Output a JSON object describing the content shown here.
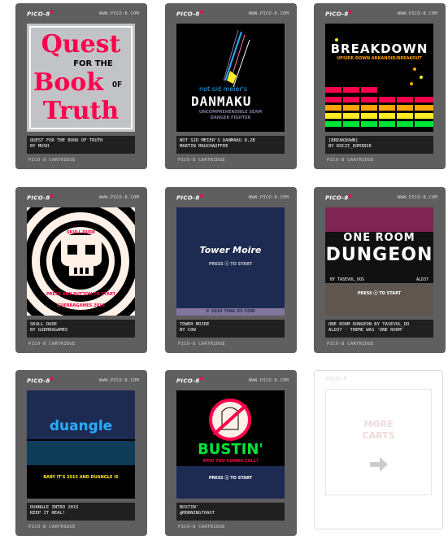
{
  "cart_common": {
    "brand": "PICO-8",
    "url": "WWW.PICO-8.COM",
    "footer": "PICO-8 CARTRIDGE"
  },
  "carts": [
    {
      "title_line1": "QUEST FOR THE BOOK OF TRUTH",
      "title_line2": "BY MUSH",
      "art": {
        "line1": "Quest",
        "line2": "FOR THE",
        "line3": "Book",
        "line3b": "OF",
        "line4": "Truth"
      }
    },
    {
      "title_line1": "NOT SID MEIER'S DANMAKU 0.2B",
      "title_line2": "MARTIN MAUCHAUFFEE",
      "art": {
        "line1": "not sid meier's",
        "line2": "DANMAKU",
        "line3": "UNCOMPREHENSIBLE SEAM",
        "line4": "DANGER FIGHTER"
      }
    },
    {
      "title_line1": "[BREAKDOWN]",
      "title_line2": "BY DOCZI_DOMINIK",
      "art": {
        "line1": "BREAKDOWN",
        "line2": "UPSIDE-DOWN ARKANOID/BREAKOUT"
      }
    },
    {
      "title_line1": "SKULL DUDE",
      "title_line2": "BY GUERRAGAMES",
      "art": {
        "line1": "SKULL DUDE",
        "line2": "PRESS ANY BUTTON TO START",
        "line3": "GUERRAGAMES 2016"
      }
    },
    {
      "title_line1": "TOWER MOIRE",
      "title_line2": "BY COW",
      "art": {
        "line1": "Tower Moire",
        "line2": "PRESS ⓧ TO START",
        "line3": "® 2016 TOAL ES COW"
      }
    },
    {
      "title_line1": "ONE ROOM DUNGEON BY TASEVOL_DO",
      "title_line2": "ALD37 - THEME WAS 'ONE ROOM'",
      "art": {
        "line1": "ONE ROOM",
        "line2": "DUNGEON",
        "line3": "BY TASEVOL_DOS",
        "line3b": "ALD37",
        "line4": "PRESS ⓧ TO START"
      }
    },
    {
      "title_line1": "DUANGLE INTRO 2015",
      "title_line2": "KEEP IT REAL!",
      "art": {
        "line1": "duangle",
        "line2": "BABY IT'S 2015 AND DUANGLE IS"
      }
    },
    {
      "title_line1": "BUSTIN'",
      "title_line2": "@MORNINGTOAST",
      "art": {
        "line1": "BUSTIN'",
        "line2": "WHO YOU GONNA CALL?",
        "line3": "PRESS ⓧ TO START"
      }
    }
  ],
  "more": {
    "brand": "PICO-8",
    "line1": "MORE",
    "line2": "CARTS",
    "arrow_icon": "arrow-right-icon"
  }
}
